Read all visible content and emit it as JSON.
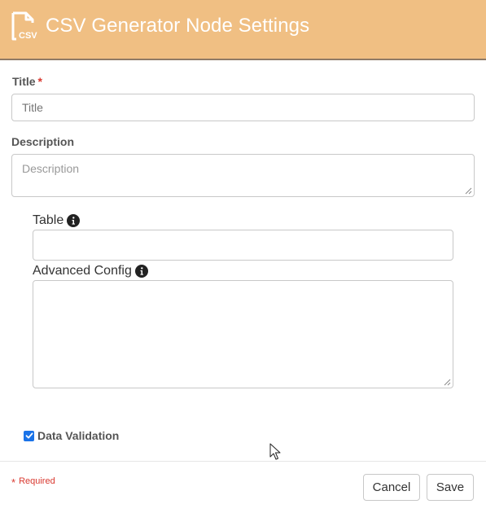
{
  "header": {
    "title": "CSV Generator Node Settings",
    "icon": "csv-file-icon",
    "icon_text": "CSV",
    "bg_color": "#f0bf83"
  },
  "form": {
    "title_label": "Title",
    "title_required_mark": "*",
    "title_placeholder": "Title",
    "title_value": "",
    "description_label": "Description",
    "description_placeholder": "Description",
    "description_value": "",
    "table_label": "Table",
    "table_value": "",
    "advanced_config_label": "Advanced Config",
    "advanced_config_value": "",
    "data_validation_label": "Data Validation",
    "data_validation_checked": true
  },
  "footer": {
    "required_mark": "*",
    "required_text": "Required",
    "cancel_label": "Cancel",
    "save_label": "Save"
  },
  "colors": {
    "accent": "#f0bf83",
    "required": "#d9382f",
    "checkbox": "#1a73e8"
  }
}
